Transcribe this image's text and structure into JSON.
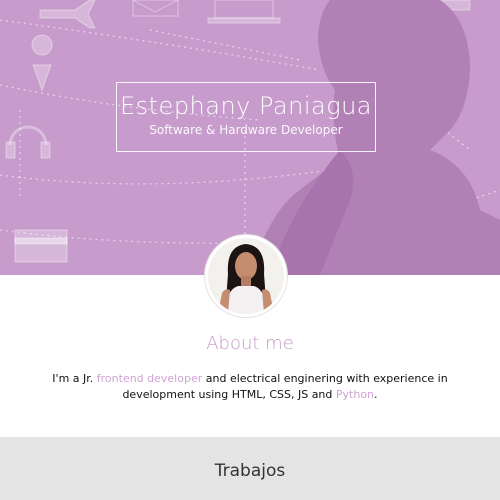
{
  "header": {
    "name": "Estephany Paniagua",
    "subtitle": "Software & Hardware Developer"
  },
  "about": {
    "title": "About me",
    "text_1": "I'm a Jr. ",
    "highlight_1": "frontend developer",
    "text_2": " and electrical enginering with experience in development using HTML, CSS, JS and ",
    "highlight_2": "Python",
    "text_3": "."
  },
  "works": {
    "title": "Trabajos"
  },
  "colors": {
    "hero_bg": "#c79bcb",
    "accent": "#c49ac9",
    "works_bg": "#e4e4e4"
  },
  "icons": [
    "airplane-icon",
    "envelope-icon",
    "laptop-icon",
    "location-pin-icon",
    "headphones-icon",
    "credit-card-icon"
  ]
}
